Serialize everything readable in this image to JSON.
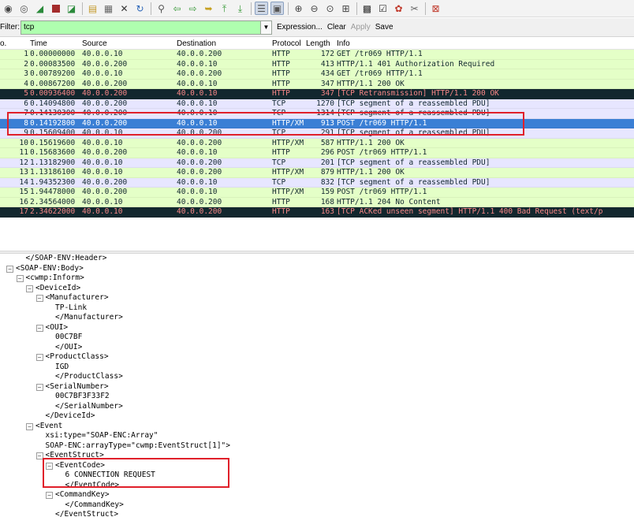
{
  "toolbar": {
    "icons": [
      "interface-list-icon",
      "options-icon",
      "start-capture-icon",
      "stop-capture-icon",
      "restart-capture-icon",
      "open-file-icon",
      "save-file-icon",
      "close-file-icon",
      "reload-icon",
      "print-icon",
      "find-icon",
      "back-icon",
      "forward-icon",
      "go-to-icon",
      "first-packet-icon",
      "last-packet-icon",
      "colorize-icon",
      "autoscroll-icon",
      "zoom-in-icon",
      "zoom-out-icon",
      "zoom-normal-icon",
      "resize-columns-icon",
      "capture-filters-icon",
      "display-filters-icon",
      "coloring-rules-icon",
      "preferences-icon",
      "help-icon"
    ]
  },
  "filter": {
    "label": "Filter:",
    "value": "tcp",
    "expression": "Expression...",
    "clear": "Clear",
    "apply": "Apply",
    "save": "Save"
  },
  "columns": {
    "no": "o.",
    "time": "Time",
    "source": "Source",
    "destination": "Destination",
    "protocol": "Protocol",
    "length": "Length",
    "info": "Info"
  },
  "packets": [
    {
      "no": "1",
      "time": "0.00000000",
      "src": "40.0.0.10",
      "dst": "40.0.0.200",
      "proto": "HTTP",
      "len": "172",
      "info": "GET /tr069 HTTP/1.1",
      "style": "http"
    },
    {
      "no": "2",
      "time": "0.00083500",
      "src": "40.0.0.200",
      "dst": "40.0.0.10",
      "proto": "HTTP",
      "len": "413",
      "info": "HTTP/1.1 401 Authorization Required",
      "style": "http"
    },
    {
      "no": "3",
      "time": "0.00789200",
      "src": "40.0.0.10",
      "dst": "40.0.0.200",
      "proto": "HTTP",
      "len": "434",
      "info": "GET /tr069 HTTP/1.1",
      "style": "http"
    },
    {
      "no": "4",
      "time": "0.00867200",
      "src": "40.0.0.200",
      "dst": "40.0.0.10",
      "proto": "HTTP",
      "len": "347",
      "info": "HTTP/1.1 200 OK",
      "style": "http"
    },
    {
      "no": "5",
      "time": "0.00936400",
      "src": "40.0.0.200",
      "dst": "40.0.0.10",
      "proto": "HTTP",
      "len": "347",
      "info": "[TCP Retransmission] HTTP/1.1 200 OK",
      "style": "bad"
    },
    {
      "no": "6",
      "time": "0.14094800",
      "src": "40.0.0.200",
      "dst": "40.0.0.10",
      "proto": "TCP",
      "len": "1270",
      "info": "[TCP segment of a reassembled PDU]",
      "style": "tcp"
    },
    {
      "no": "7",
      "time": "0.14130300",
      "src": "40.0.0.200",
      "dst": "40.0.0.10",
      "proto": "TCP",
      "len": "1314",
      "info": "[TCP segment of a reassembled PDU]",
      "style": "tcp"
    },
    {
      "no": "8",
      "time": "0.14192800",
      "src": "40.0.0.200",
      "dst": "40.0.0.10",
      "proto": "HTTP/XM",
      "len": "913",
      "info": "POST /tr069 HTTP/1.1",
      "style": "sel"
    },
    {
      "no": "9",
      "time": "0.15609400",
      "src": "40.0.0.10",
      "dst": "40.0.0.200",
      "proto": "TCP",
      "len": "291",
      "info": "[TCP segment of a reassembled PDU]",
      "style": "tcp"
    },
    {
      "no": "10",
      "time": "0.15619600",
      "src": "40.0.0.10",
      "dst": "40.0.0.200",
      "proto": "HTTP/XM",
      "len": "587",
      "info": "HTTP/1.1 200 OK",
      "style": "http"
    },
    {
      "no": "11",
      "time": "0.15683600",
      "src": "40.0.0.200",
      "dst": "40.0.0.10",
      "proto": "HTTP",
      "len": "296",
      "info": "POST /tr069 HTTP/1.1",
      "style": "http"
    },
    {
      "no": "12",
      "time": "1.13182900",
      "src": "40.0.0.10",
      "dst": "40.0.0.200",
      "proto": "TCP",
      "len": "201",
      "info": "[TCP segment of a reassembled PDU]",
      "style": "tcp"
    },
    {
      "no": "13",
      "time": "1.13186100",
      "src": "40.0.0.10",
      "dst": "40.0.0.200",
      "proto": "HTTP/XM",
      "len": "879",
      "info": "HTTP/1.1 200 OK",
      "style": "http"
    },
    {
      "no": "14",
      "time": "1.94352300",
      "src": "40.0.0.200",
      "dst": "40.0.0.10",
      "proto": "TCP",
      "len": "832",
      "info": "[TCP segment of a reassembled PDU]",
      "style": "tcp"
    },
    {
      "no": "15",
      "time": "1.94478000",
      "src": "40.0.0.200",
      "dst": "40.0.0.10",
      "proto": "HTTP/XM",
      "len": "159",
      "info": "POST /tr069 HTTP/1.1",
      "style": "http"
    },
    {
      "no": "16",
      "time": "2.34564000",
      "src": "40.0.0.10",
      "dst": "40.0.0.200",
      "proto": "HTTP",
      "len": "168",
      "info": "HTTP/1.1 204 No Content",
      "style": "http"
    },
    {
      "no": "17",
      "time": "2.34622000",
      "src": "40.0.0.10",
      "dst": "40.0.0.200",
      "proto": "HTTP",
      "len": "163",
      "info": "[TCP ACKed unseen segment] HTTP/1.1 400 Bad Request  (text/p",
      "style": "bad"
    }
  ],
  "tree": [
    {
      "text": "</SOAP-ENV:Header>",
      "level": 2,
      "toggle": false
    },
    {
      "text": "<SOAP-ENV:Body>",
      "level": 1,
      "toggle": true
    },
    {
      "text": "<cwmp:Inform>",
      "level": 2,
      "toggle": true
    },
    {
      "text": "<DeviceId>",
      "level": 3,
      "toggle": true
    },
    {
      "text": "<Manufacturer>",
      "level": 4,
      "toggle": true
    },
    {
      "text": "TP-Link",
      "level": 5,
      "toggle": false
    },
    {
      "text": "</Manufacturer>",
      "level": 5,
      "toggle": false
    },
    {
      "text": "<OUI>",
      "level": 4,
      "toggle": true
    },
    {
      "text": "00C7BF",
      "level": 5,
      "toggle": false
    },
    {
      "text": "</OUI>",
      "level": 5,
      "toggle": false
    },
    {
      "text": "<ProductClass>",
      "level": 4,
      "toggle": true
    },
    {
      "text": "IGD",
      "level": 5,
      "toggle": false
    },
    {
      "text": "</ProductClass>",
      "level": 5,
      "toggle": false
    },
    {
      "text": "<SerialNumber>",
      "level": 4,
      "toggle": true
    },
    {
      "text": "00C7BF3F33F2",
      "level": 5,
      "toggle": false
    },
    {
      "text": "</SerialNumber>",
      "level": 5,
      "toggle": false
    },
    {
      "text": "</DeviceId>",
      "level": 4,
      "toggle": false
    },
    {
      "text": "<Event",
      "level": 3,
      "toggle": true
    },
    {
      "text": "xsi:type=\"SOAP-ENC:Array\"",
      "level": 4,
      "toggle": false
    },
    {
      "text": "SOAP-ENC:arrayType=\"cwmp:EventStruct[1]\">",
      "level": 4,
      "toggle": false
    },
    {
      "text": "<EventStruct>",
      "level": 4,
      "toggle": true
    },
    {
      "text": "<EventCode>",
      "level": 5,
      "toggle": true
    },
    {
      "text": "6 CONNECTION REQUEST",
      "level": 6,
      "toggle": false
    },
    {
      "text": "</EventCode>",
      "level": 6,
      "toggle": false
    },
    {
      "text": "<CommandKey>",
      "level": 5,
      "toggle": true
    },
    {
      "text": "</CommandKey>",
      "level": 6,
      "toggle": false
    },
    {
      "text": "</EventStruct>",
      "level": 5,
      "toggle": false
    }
  ],
  "colors": {
    "http_bg": "#e4ffc7",
    "tcp_bg": "#e7e6ff",
    "bad_bg": "#12272e",
    "bad_fg": "#f78787",
    "selected_bg": "#3a7fd5",
    "filter_bg": "#afffaf",
    "highlight_box": "#e0202a"
  }
}
